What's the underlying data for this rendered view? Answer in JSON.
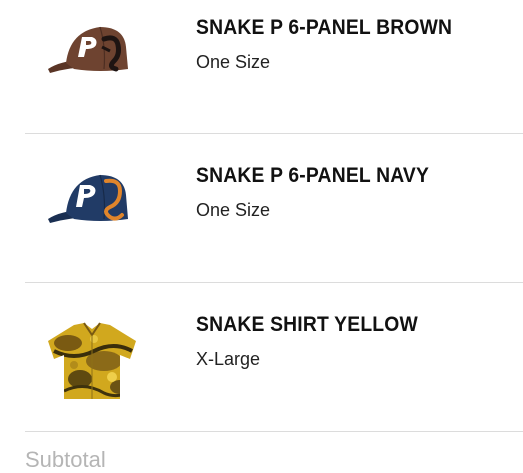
{
  "cart": {
    "items": [
      {
        "title": "SNAKE P 6-PANEL BROWN",
        "variant": "One Size",
        "image": "brown-cap-image"
      },
      {
        "title": "SNAKE P 6-PANEL NAVY",
        "variant": "One Size",
        "image": "navy-cap-image"
      },
      {
        "title": "SNAKE SHIRT YELLOW",
        "variant": "X-Large",
        "image": "yellow-shirt-image"
      }
    ],
    "subtotal_label": "Subtotal"
  },
  "colors": {
    "brown_cap": "#6e4330",
    "navy_cap": "#213b66",
    "shirt_yellow": "#d1a81e",
    "divider": "#dcdcdc",
    "subtotal_text": "#b5b5b5"
  }
}
